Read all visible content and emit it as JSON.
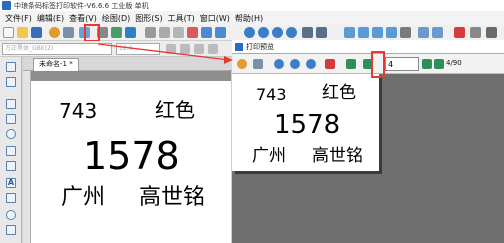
{
  "app": {
    "title": "中琅条码标签打印软件-V6.6.6 工业版 单机"
  },
  "menu": [
    "文件(F)",
    "编辑(E)",
    "查看(V)",
    "绘图(D)",
    "图形(S)",
    "工具(T)",
    "窗口(W)",
    "帮助(H)"
  ],
  "toolbar": {
    "font_placeholder": "方正黑体_GBK(2)",
    "font_size": "12.0"
  },
  "document": {
    "tab_label": "未命名-1 *"
  },
  "label": {
    "number": "743",
    "color": "红色",
    "code": "1578",
    "city": "广州",
    "name": "高世铭"
  },
  "preview": {
    "window_title": "打印预览",
    "page_current": "4",
    "page_total": "4/90"
  },
  "annotation": {
    "highlight_color": "#e53935"
  },
  "colors": {
    "accent": "#2b6cc4",
    "canvas_bg": "#8e8e8e",
    "preview_bg": "#6e6e6e"
  }
}
